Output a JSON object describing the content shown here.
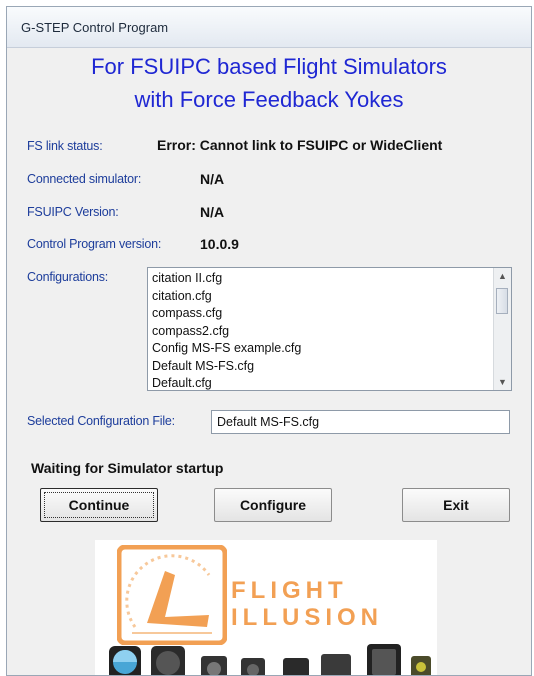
{
  "window": {
    "title": "G-STEP  Control Program"
  },
  "header": {
    "line1": "For FSUIPC based Flight Simulators",
    "line2": "with Force Feedback Yokes"
  },
  "info": {
    "fs_link_label": "FS link status:",
    "fs_link_value": "Error: Cannot link to FSUIPC or WideClient",
    "simulator_label": "Connected simulator:",
    "simulator_value": "N/A",
    "fsuipc_label": "FSUIPC Version:",
    "fsuipc_value": "N/A",
    "program_label": "Control Program version:",
    "program_value": "10.0.9"
  },
  "configurations": {
    "label": "Configurations:",
    "items": [
      "citation II.cfg",
      "citation.cfg",
      "compass.cfg",
      "compass2.cfg",
      "Config MS-FS example.cfg",
      "Default MS-FS.cfg",
      "Default.cfg"
    ]
  },
  "selected": {
    "label": "Selected Configuration File:",
    "value": "Default MS-FS.cfg"
  },
  "status": "Waiting for Simulator startup",
  "buttons": {
    "continue": "Continue",
    "configure": "Configure",
    "exit": "Exit"
  },
  "logo": {
    "line1": "FLIGHT",
    "line2": "ILLUSION",
    "accent": "#f2a054"
  },
  "colors": {
    "headline": "#1f27d3",
    "label": "#1d3d9b"
  }
}
